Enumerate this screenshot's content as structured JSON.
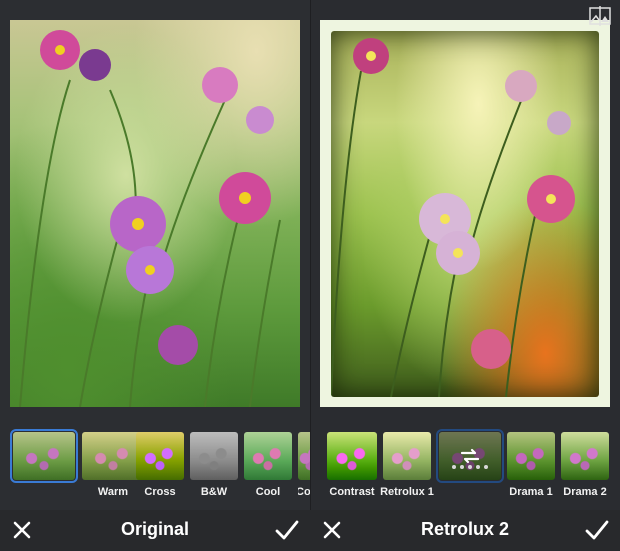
{
  "left_panel": {
    "title": "Original",
    "filters": [
      {
        "id": "original",
        "label": "",
        "selected": true
      },
      {
        "id": "warm",
        "label": "Warm"
      },
      {
        "id": "cross",
        "label": "Cross"
      },
      {
        "id": "bw",
        "label": "B&W"
      },
      {
        "id": "cool",
        "label": "Cool"
      },
      {
        "id": "cut",
        "label": "Co"
      }
    ]
  },
  "right_panel": {
    "title": "Retrolux 2",
    "filters": [
      {
        "id": "contrast",
        "label": "Contrast"
      },
      {
        "id": "retro1",
        "label": "Retrolux 1"
      },
      {
        "id": "retro2",
        "label": "",
        "selected": true
      },
      {
        "id": "drama1",
        "label": "Drama 1"
      },
      {
        "id": "drama2",
        "label": "Drama 2"
      }
    ]
  },
  "icons": {
    "close": "close-icon",
    "confirm": "checkmark-icon",
    "refresh": "refresh-icon",
    "compare": "compare-icon"
  },
  "colors": {
    "selection": "#3a7bd5",
    "bar": "#28292c",
    "frame": "#eef5e0"
  }
}
